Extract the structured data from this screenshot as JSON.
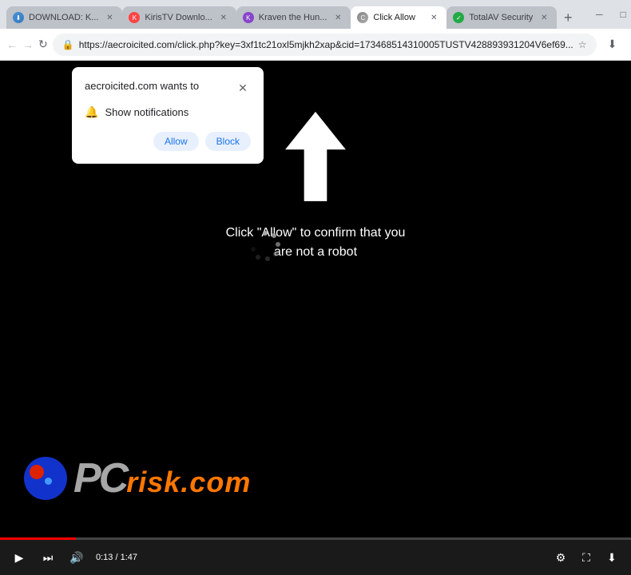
{
  "browser": {
    "tabs": [
      {
        "id": "tab1",
        "title": "DOWNLOAD: K...",
        "favicon": "download",
        "active": false
      },
      {
        "id": "tab2",
        "title": "KirisTV Downlo...",
        "favicon": "kiris",
        "active": false
      },
      {
        "id": "tab3",
        "title": "Kraven the Hun...",
        "favicon": "kraven",
        "active": false
      },
      {
        "id": "tab4",
        "title": "Click Allow",
        "favicon": "click",
        "active": true
      },
      {
        "id": "tab5",
        "title": "TotalAV Security",
        "favicon": "totalav",
        "active": false
      }
    ],
    "url": "https://aecroicited.com/click.php?key=3xf1tc21oxl5mjkh2xap&cid=173468514310005TUSTV428893931204V6ef69...",
    "nav": {
      "back_disabled": true,
      "forward_disabled": true
    }
  },
  "popup": {
    "title": "aecroicited.com wants to",
    "notification_label": "Show notifications",
    "allow_label": "Allow",
    "block_label": "Block"
  },
  "page": {
    "bg_color": "#000000",
    "instruction_line1": "Click \"Allow\" to confirm that you",
    "instruction_line2": "are not a robot"
  },
  "video_controls": {
    "time_current": "0:13",
    "time_total": "1:47"
  },
  "pcrisk": {
    "pc_text": "PC",
    "risk_text": "risk.com"
  },
  "icons": {
    "back": "←",
    "forward": "→",
    "reload": "↻",
    "star": "☆",
    "download": "⬇",
    "profile": "👤",
    "menu": "⋮",
    "lock": "🔒",
    "close": "✕",
    "bell": "🔔",
    "play": "▶",
    "skip": "⏭",
    "volume": "🔊",
    "settings": "⚙",
    "fullscreen": "⛶",
    "download_video": "⬇",
    "minimize": "─",
    "maximize": "□",
    "win_close": "✕",
    "new_tab": "+"
  }
}
